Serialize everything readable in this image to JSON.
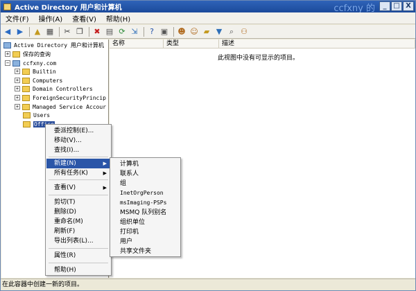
{
  "window": {
    "title": "Active Directory 用户和计算机",
    "watermark": "ccfxny 的",
    "controls": {
      "minimize": "_",
      "maximize": "□",
      "close": "X"
    }
  },
  "menubar": {
    "items": [
      "文件(F)",
      "操作(A)",
      "查看(V)",
      "帮助(H)"
    ]
  },
  "toolbar": {
    "icons": [
      "back-icon",
      "forward-icon",
      "up-icon",
      "details-icon",
      "cut-icon",
      "copy-icon",
      "delete-icon",
      "properties-icon",
      "refresh-icon",
      "export-icon",
      "help-icon",
      "console-icon",
      "add-user-icon",
      "add-group-icon",
      "add-ou-icon",
      "filter-icon",
      "find-icon",
      "add-to-group-icon"
    ]
  },
  "tree": {
    "root": "Active Directory 用户和计算机",
    "saved_queries": "保存的查询",
    "domain": "ccfxny.com",
    "children": [
      {
        "label": "Builtin",
        "expander": "+"
      },
      {
        "label": "Computers",
        "expander": "+"
      },
      {
        "label": "Domain Controllers",
        "expander": "+"
      },
      {
        "label": "ForeignSecurityPrincip",
        "expander": "+"
      },
      {
        "label": "Managed Service Accour",
        "expander": "+"
      },
      {
        "label": "Users",
        "expander": ""
      },
      {
        "label": "Office",
        "expander": "",
        "selected": true
      }
    ]
  },
  "list": {
    "columns": [
      "名称",
      "类型",
      "描述"
    ],
    "empty_message": "此视图中没有可显示的项目。"
  },
  "context_menu": {
    "items": [
      "委派控制(E)...",
      "移动(V)...",
      "查找(I)...",
      "新建(N)",
      "所有任务(K)",
      "查看(V)",
      "剪切(T)",
      "删除(D)",
      "重命名(M)",
      "刷新(F)",
      "导出列表(L)...",
      "属性(R)",
      "帮助(H)"
    ],
    "active": "新建(N)"
  },
  "submenu": {
    "items": [
      "计算机",
      "联系人",
      "组",
      "InetOrgPerson",
      "msImaging-PSPs",
      "MSMQ 队列别名",
      "组织单位",
      "打印机",
      "用户",
      "共享文件夹"
    ]
  },
  "status": {
    "text": "在此容器中创建一新的项目。"
  },
  "colors": {
    "titlebar": "#1b4a9b",
    "selection": "#2b56a8",
    "folder": "#f2cd53"
  }
}
